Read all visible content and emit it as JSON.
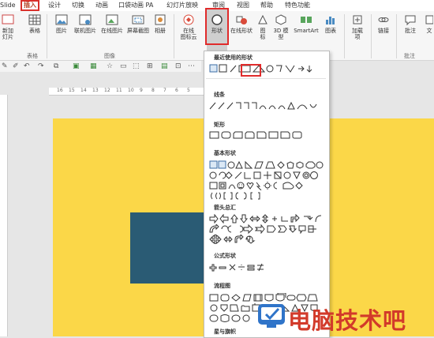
{
  "menubar": {
    "tabs": [
      "Slide",
      "插入",
      "设计",
      "切换",
      "动画",
      "口袋动画 PA",
      "幻灯片放映",
      "审阅",
      "视图",
      "帮助",
      "特色功能"
    ],
    "active_tab": "插入"
  },
  "ribbon": {
    "buttons": [
      {
        "label": "新加\n灯片",
        "icon": "new-slide-icon"
      },
      {
        "label": "表格",
        "icon": "table-icon"
      },
      {
        "label": "图片",
        "icon": "picture-icon"
      },
      {
        "label": "联机图片",
        "icon": "online-picture-icon"
      },
      {
        "label": "在线图片",
        "icon": "online-image-icon"
      },
      {
        "label": "屏幕截图",
        "icon": "screenshot-icon"
      },
      {
        "label": "相册",
        "icon": "album-icon"
      },
      {
        "label": "在线\n图标云",
        "icon": "icon-cloud-icon"
      },
      {
        "label": "形状",
        "icon": "shape-icon"
      },
      {
        "label": "在线形状",
        "icon": "online-shape-icon"
      },
      {
        "label": "图\n标",
        "icon": "icons-icon"
      },
      {
        "label": "3D 模\n型",
        "icon": "3d-model-icon"
      },
      {
        "label": "SmartArt",
        "icon": "smartart-icon"
      },
      {
        "label": "图表",
        "icon": "chart-icon"
      },
      {
        "label": "加载\n项",
        "icon": "addin-icon"
      },
      {
        "label": "链接",
        "icon": "link-icon"
      },
      {
        "label": "批注",
        "icon": "comment-icon"
      },
      {
        "label": "文",
        "icon": "text-icon"
      }
    ],
    "groups": [
      "表格",
      "图像",
      "批注"
    ]
  },
  "ruler": {
    "ticks": [
      "16",
      "15",
      "14",
      "13",
      "12",
      "11",
      "10",
      "9",
      "8",
      "7",
      "6",
      "5"
    ]
  },
  "shape_menu": {
    "sections": [
      "最近使用的形状",
      "线条",
      "矩形",
      "基本形状",
      "箭头总汇",
      "公式形状",
      "流程图",
      "星与旗帜"
    ]
  },
  "watermark": {
    "text": "电脑技术吧"
  },
  "colors": {
    "slide_bg": "#fbd748",
    "rect": "#2a5b74",
    "highlight": "#e02b2b",
    "accent": "#b7472a"
  }
}
